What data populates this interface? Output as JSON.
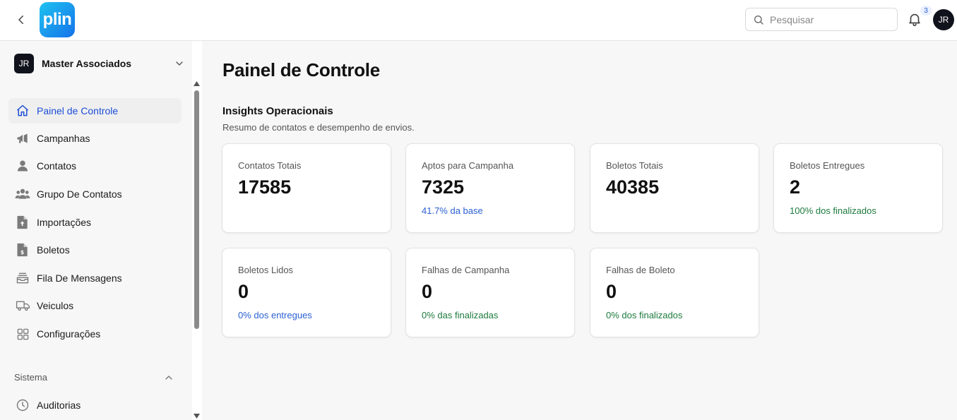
{
  "header": {
    "logo_text": "plin",
    "search_placeholder": "Pesquisar",
    "notifications_count": "3",
    "user_initials": "JR"
  },
  "sidebar": {
    "org_initials": "JR",
    "org_name": "Master Associados",
    "items": [
      {
        "label": "Painel de Controle",
        "icon": "home-icon",
        "active": true
      },
      {
        "label": "Campanhas",
        "icon": "megaphone-icon"
      },
      {
        "label": "Contatos",
        "icon": "user-icon"
      },
      {
        "label": "Grupo De Contatos",
        "icon": "users-icon"
      },
      {
        "label": "Importações",
        "icon": "file-upload-icon"
      },
      {
        "label": "Boletos",
        "icon": "file-dollar-icon"
      },
      {
        "label": "Fila De Mensagens",
        "icon": "inbox-stack-icon"
      },
      {
        "label": "Veiculos",
        "icon": "truck-icon"
      },
      {
        "label": "Configurações",
        "icon": "grid-icon"
      }
    ],
    "section_label": "Sistema",
    "section_items": [
      {
        "label": "Auditorias",
        "icon": "clock-icon"
      }
    ]
  },
  "main": {
    "title": "Painel de Controle",
    "section_title": "Insights Operacionais",
    "section_subtitle": "Resumo de contatos e desempenho de envios.",
    "cards": [
      {
        "label": "Contatos Totais",
        "value": "17585",
        "note": ""
      },
      {
        "label": "Aptos para Campanha",
        "value": "7325",
        "note": "41.7% da base",
        "note_color": "blue"
      },
      {
        "label": "Boletos Totais",
        "value": "40385",
        "note": ""
      },
      {
        "label": "Boletos Entregues",
        "value": "2",
        "note": "100% dos finalizados",
        "note_color": "green"
      },
      {
        "label": "Boletos Lidos",
        "value": "0",
        "note": "0% dos entregues",
        "note_color": "blue"
      },
      {
        "label": "Falhas de Campanha",
        "value": "0",
        "note": "0% das finalizadas",
        "note_color": "green"
      },
      {
        "label": "Falhas de Boleto",
        "value": "0",
        "note": "0% dos finalizados",
        "note_color": "green"
      }
    ]
  },
  "colors": {
    "accent": "#1d4fd7",
    "note_blue": "#2a5fd1",
    "note_green": "#1e7a3e"
  }
}
